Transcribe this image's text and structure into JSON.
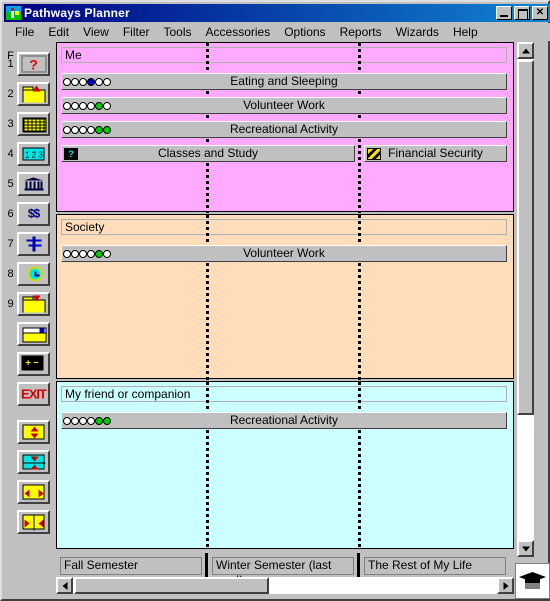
{
  "window": {
    "title": "Pathways Planner",
    "app_icon": "pathways-app-icon",
    "controls": {
      "minimize": "_",
      "maximize": "□",
      "close": "✕"
    }
  },
  "menu": {
    "items": [
      "File",
      "Edit",
      "View",
      "Filter",
      "Tools",
      "Accessories",
      "Options",
      "Reports",
      "Wizards",
      "Help"
    ]
  },
  "toolbar": {
    "items": [
      {
        "key": "F",
        "icon": "question-mark-icon",
        "name": "help-question-button"
      },
      {
        "key": "1",
        "icon": "question-mark-selected-icon",
        "name": "new-goal-button"
      },
      {
        "key": "2",
        "icon": "folder-up-icon",
        "name": "open-folder-button"
      },
      {
        "key": "3",
        "icon": "grid-table-icon",
        "name": "table-view-button"
      },
      {
        "key": "4",
        "icon": "numbered-list-icon",
        "name": "numbered-list-button"
      },
      {
        "key": "5",
        "icon": "bank-building-icon",
        "name": "bank-button"
      },
      {
        "key": "6",
        "icon": "money-transfer-icon",
        "name": "money-transfer-button"
      },
      {
        "key": "7",
        "icon": "filter-icon",
        "name": "filter-button"
      },
      {
        "key": "8",
        "icon": "clock-icon",
        "name": "schedule-button"
      },
      {
        "key": "9",
        "icon": "folder-down-icon",
        "name": "save-folder-button"
      },
      {
        "key": "",
        "icon": "note-card-icon",
        "name": "note-button"
      },
      {
        "key": "",
        "icon": "calculator-icon",
        "name": "calculator-button"
      },
      {
        "key": "",
        "icon": "exit-icon",
        "name": "exit-button"
      },
      {
        "key": "",
        "icon": "expand-vertical-icon",
        "name": "expand-vertical-button"
      },
      {
        "key": "",
        "icon": "contract-vertical-icon",
        "name": "contract-vertical-button"
      },
      {
        "key": "",
        "icon": "expand-horizontal-icon",
        "name": "expand-horizontal-button"
      },
      {
        "key": "",
        "icon": "contract-horizontal-icon",
        "name": "contract-horizontal-button"
      }
    ]
  },
  "chart": {
    "bands": [
      {
        "title": "Me",
        "color": "#ffaaff",
        "bars": [
          {
            "label": "Eating and Sleeping",
            "dots": [
              "white",
              "white",
              "white",
              "blue",
              "white",
              "white"
            ],
            "icon": null,
            "span": "full"
          },
          {
            "label": "Volunteer Work",
            "dots": [
              "white",
              "white",
              "white",
              "white",
              "green",
              "white"
            ],
            "icon": null,
            "span": "full"
          },
          {
            "label": "Recreational Activity",
            "dots": [
              "white",
              "white",
              "white",
              "white",
              "green",
              "green"
            ],
            "icon": null,
            "span": "full"
          },
          {
            "label": "Classes and Study",
            "dots": [],
            "icon": "question-badge-icon",
            "span": "left-two"
          },
          {
            "label": "Financial Security",
            "dots": [],
            "icon": "hatch-badge-icon",
            "span": "right-one"
          }
        ]
      },
      {
        "title": "Society",
        "color": "#ffddbb",
        "bars": [
          {
            "label": "Volunteer Work",
            "dots": [
              "white",
              "white",
              "white",
              "white",
              "green",
              "white"
            ],
            "icon": null,
            "span": "full"
          }
        ]
      },
      {
        "title": "My friend or companion",
        "color": "#ccffff",
        "bars": [
          {
            "label": "Recreational Activity",
            "dots": [
              "white",
              "white",
              "white",
              "white",
              "green",
              "green"
            ],
            "icon": null,
            "span": "full"
          }
        ]
      }
    ]
  },
  "columns": [
    {
      "label": "Fall Semester"
    },
    {
      "label": "Winter Semester (last one!)"
    },
    {
      "label": "The Rest of My Life"
    }
  ],
  "statusbar": {
    "icon": "graduation-cap-icon"
  }
}
